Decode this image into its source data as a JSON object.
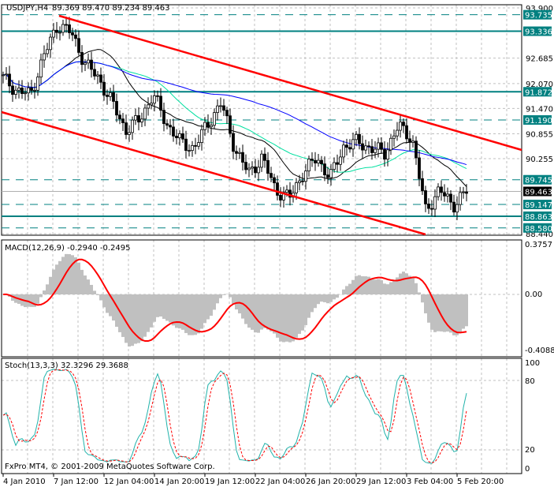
{
  "header": {
    "symbol_timeframe": "USDJPY,H4",
    "ohlc": "89.369 89.470 89.234 89.463"
  },
  "price_axis": {
    "labels": [
      "93.900",
      "92.685",
      "92.070",
      "91.470",
      "90.855",
      "90.255",
      "88.440"
    ],
    "values": [
      93.9,
      92.685,
      92.07,
      91.47,
      90.855,
      90.255,
      88.44
    ]
  },
  "levels": [
    {
      "label": "93.735",
      "value": 93.735,
      "style": "dashed"
    },
    {
      "label": "93.336",
      "value": 93.336,
      "style": "solid"
    },
    {
      "label": "91.872",
      "value": 91.872,
      "style": "solid"
    },
    {
      "label": "91.190",
      "value": 91.19,
      "style": "dashed"
    },
    {
      "label": "89.745",
      "value": 89.745,
      "style": "dashed"
    },
    {
      "label": "89.147",
      "value": 89.147,
      "style": "dashed"
    },
    {
      "label": "88.863",
      "value": 88.863,
      "style": "solid"
    },
    {
      "label": "88.580",
      "value": 88.58,
      "style": "dashed"
    }
  ],
  "current_price": {
    "label": "89.463",
    "value": 89.463
  },
  "price_path": [
    92.2,
    91.9,
    91.8,
    92.75,
    93.5,
    93.3,
    92.56,
    92.2,
    91.6,
    90.94,
    91.2,
    91.8,
    91.1,
    90.66,
    90.5,
    91.1,
    91.6,
    90.5,
    89.9,
    90.27,
    89.5,
    89.3,
    89.9,
    90.27,
    89.8,
    90.56,
    90.66,
    90.5,
    90.4,
    91.04,
    90.75,
    89.0,
    89.5,
    89.13,
    89.46
  ],
  "macd": {
    "title": "MACD(12,26,9) -0.2940 -0.2495",
    "axis_labels": [
      "0.3757",
      "0.00",
      "-0.4088"
    ]
  },
  "stoch": {
    "title": "Stoch(13,3,3) 32.3296 29.3688",
    "axis_labels": [
      "100",
      "80",
      "20",
      "0"
    ]
  },
  "x_axis": {
    "labels": [
      "4 Jan 2010",
      "7 Jan 12:00",
      "12 Jan 04:00",
      "14 Jan 20:00",
      "19 Jan 12:00",
      "22 Jan 04:00",
      "26 Jan 20:00",
      "29 Jan 12:00",
      "3 Feb 04:00",
      "5 Feb 20:00"
    ]
  },
  "copyright": "FxPro MT4, © 2001-2009 MetaQuotes Software Corp.",
  "colors": {
    "teal": "#008080",
    "trend": "#ff0000",
    "grid": "#c0c0c0",
    "hist": "#c0c0c0",
    "stoch_main": "#20b2aa",
    "ma1": "#000000",
    "ma2": "#00e0a0",
    "ma3": "#0000ff"
  }
}
